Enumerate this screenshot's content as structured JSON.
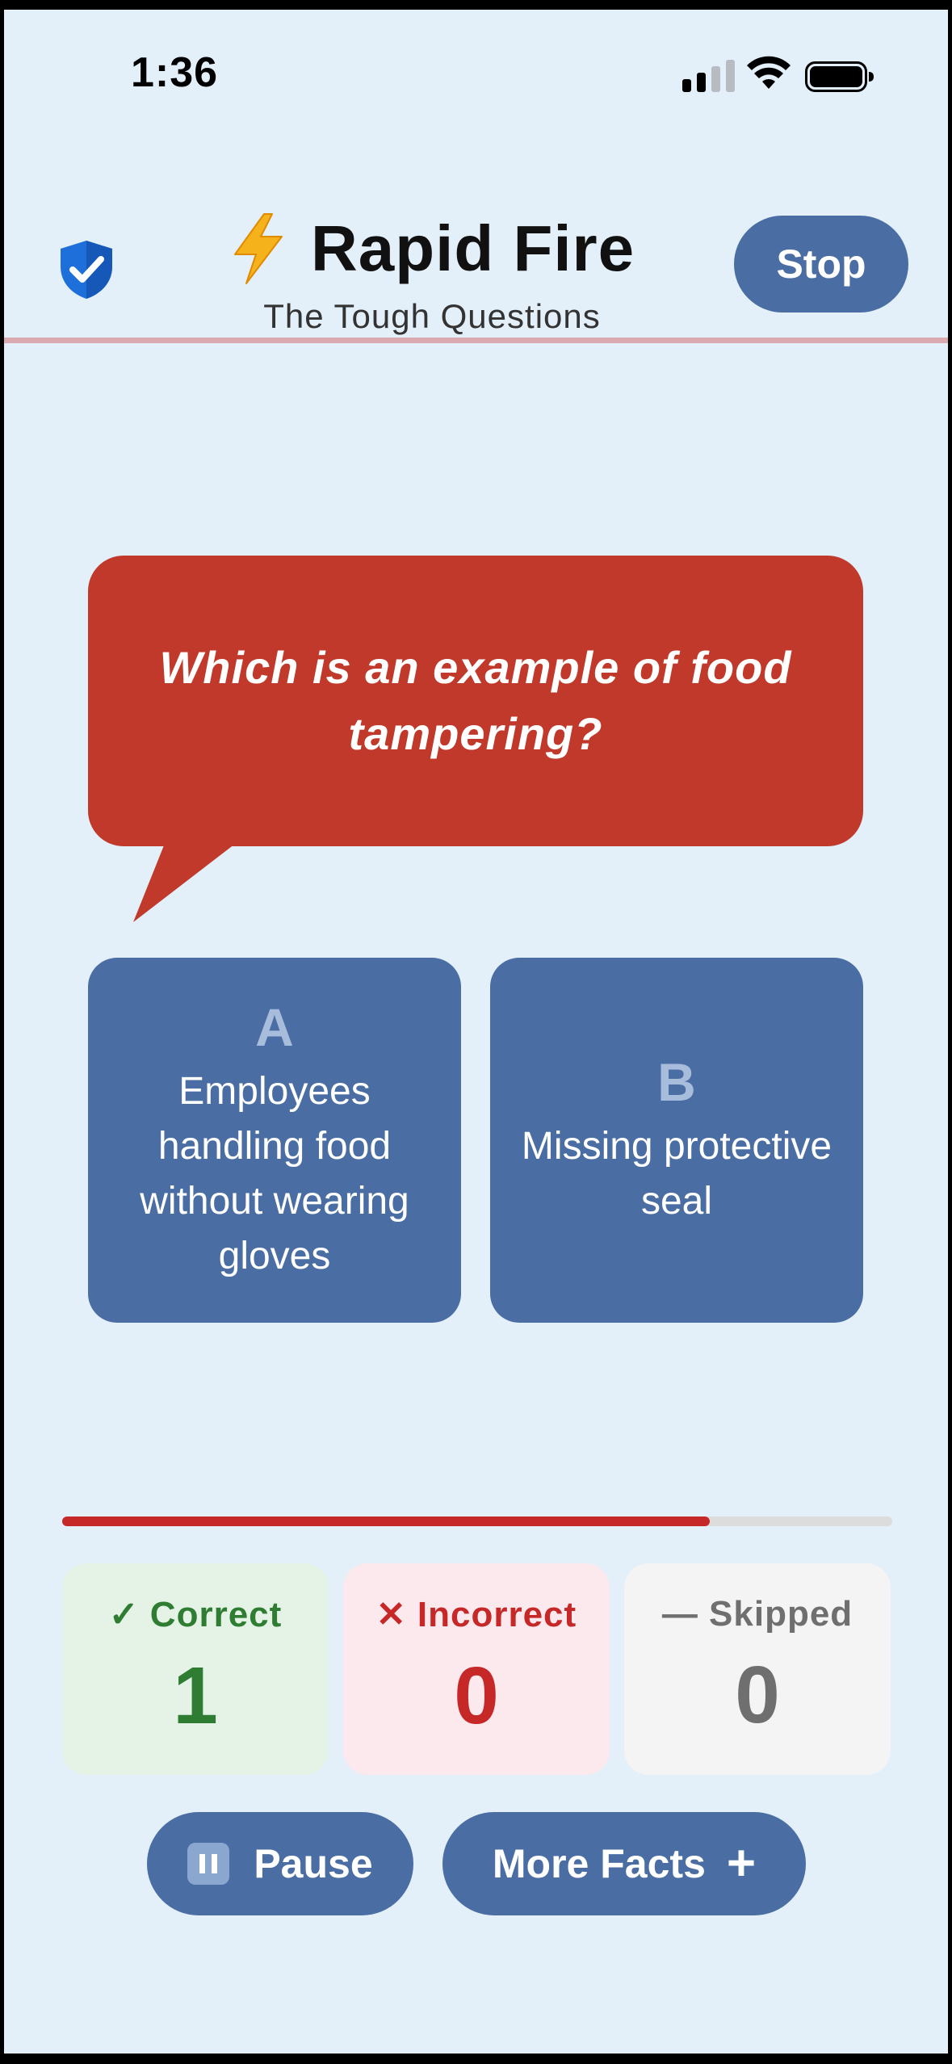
{
  "status_bar": {
    "time": "1:36",
    "signal_bars": 2
  },
  "header": {
    "title": "Rapid Fire",
    "subtitle": "The Tough Questions",
    "stop_label": "Stop"
  },
  "question": {
    "text": "Which is an example of food tampering?"
  },
  "answers": [
    {
      "letter": "A",
      "text": "Employees handling food without wearing gloves"
    },
    {
      "letter": "B",
      "text": "Missing protective seal"
    }
  ],
  "progress": {
    "fraction": 0.78
  },
  "scores": {
    "correct": {
      "label": "✓ Correct",
      "value": "1"
    },
    "incorrect": {
      "label": "✕ Incorrect",
      "value": "0"
    },
    "skipped": {
      "label": "— Skipped",
      "value": "0"
    }
  },
  "buttons": {
    "pause_label": "Pause",
    "more_facts_label": "More Facts"
  },
  "colors": {
    "background": "#e3eff9",
    "accent_blue": "#4a6da3",
    "question_red": "#c0392b",
    "correct_green": "#2e7d32",
    "incorrect_red": "#c62828",
    "skipped_gray": "#6f6f6f"
  },
  "icons": {
    "shield": "shield-check-icon",
    "bolt": "lightning-bolt-icon",
    "pause": "pause-icon",
    "plus": "plus-icon"
  }
}
